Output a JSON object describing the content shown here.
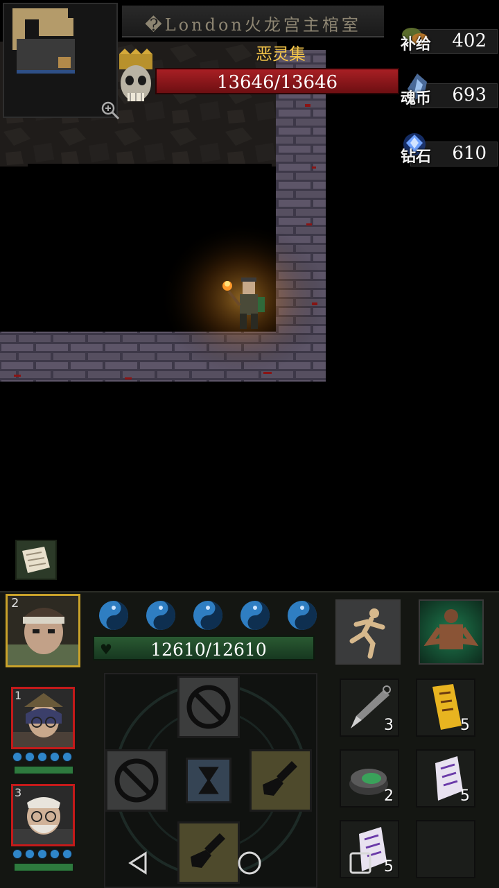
{
  "location": {
    "title": "�London火龙宫主棺室"
  },
  "boss": {
    "name": "恶灵集",
    "hp_text": "13646/13646",
    "hp_fraction": 1.0
  },
  "resources": [
    {
      "label": "补给",
      "value": "402",
      "icon": "supply-icon"
    },
    {
      "label": "魂币",
      "value": "693",
      "icon": "soul-coin-icon"
    },
    {
      "label": "钻石",
      "value": "610",
      "icon": "diamond-icon"
    }
  ],
  "hero": {
    "slot_number": "2",
    "hp_text": "12610/12610",
    "hp_fraction": 1.0,
    "spirit_orbs": 5
  },
  "party": [
    {
      "slot_number": "1"
    },
    {
      "slot_number": "3"
    }
  ],
  "items": [
    {
      "icon": "kunai-icon",
      "count": "3"
    },
    {
      "icon": "yellow-talisman-icon",
      "count": "5"
    },
    {
      "icon": "poison-bomb-icon",
      "count": "2"
    },
    {
      "icon": "purple-talisman-icon",
      "count": "5"
    },
    {
      "icon": "purple-talisman-icon",
      "count": "5"
    },
    {
      "icon": "empty-slot",
      "count": ""
    }
  ]
}
